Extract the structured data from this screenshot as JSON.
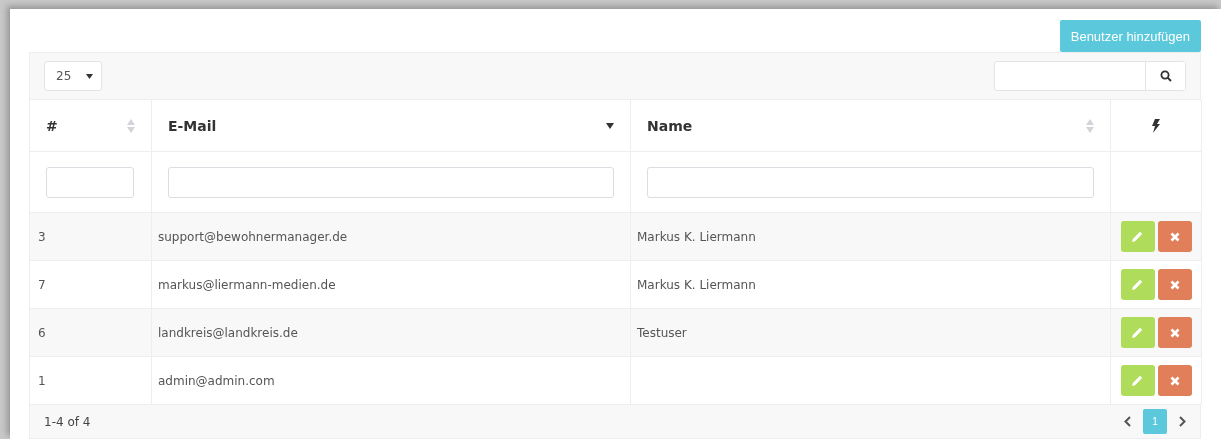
{
  "add_button": "Benutzer hinzufügen",
  "page_size": "25",
  "table": {
    "columns": [
      {
        "label": "#",
        "sorted": false
      },
      {
        "label": "E-Mail",
        "sorted": true
      },
      {
        "label": "Name",
        "sorted": false
      },
      {
        "kind": "actions"
      }
    ],
    "rows": [
      {
        "id": "3",
        "email": "support@bewohnermanager.de",
        "name": "Markus K. Liermann"
      },
      {
        "id": "7",
        "email": "markus@liermann-medien.de",
        "name": "Markus K. Liermann"
      },
      {
        "id": "6",
        "email": "landkreis@landkreis.de",
        "name": "Testuser"
      },
      {
        "id": "1",
        "email": "admin@admin.com"
      }
    ]
  },
  "footer": {
    "range": "1-4 of 4",
    "pages": [
      {
        "label": "1",
        "selected": true
      }
    ]
  }
}
